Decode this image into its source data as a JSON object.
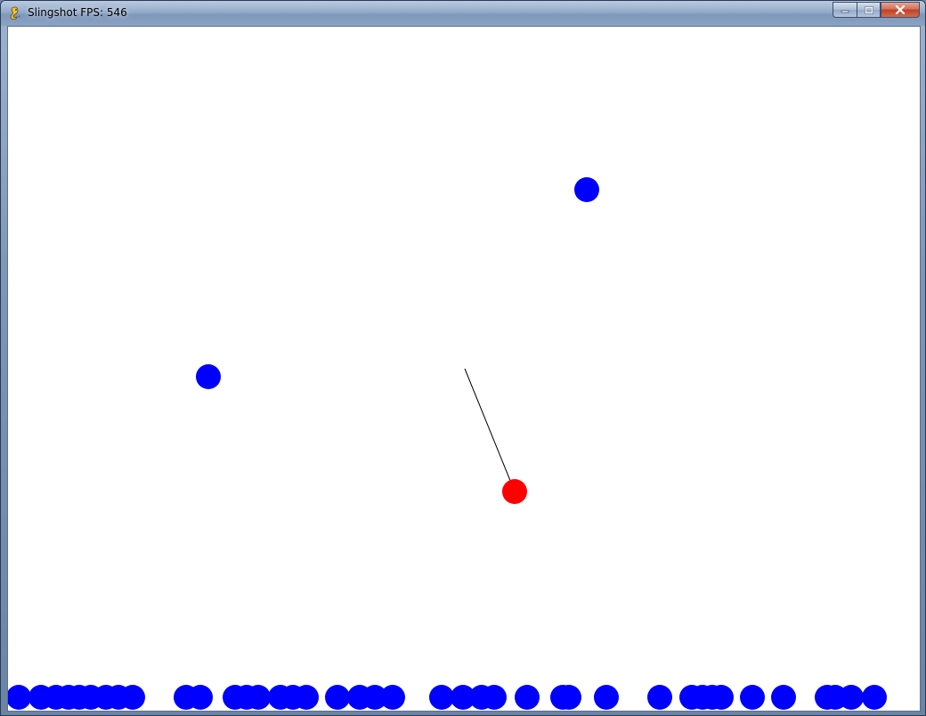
{
  "window": {
    "title": "Slingshot FPS: 546",
    "icon": "pygame-snake-icon",
    "controls": [
      "minimize",
      "maximize",
      "close"
    ]
  },
  "game": {
    "background": "#ffffff",
    "colors": {
      "planet": "#0000ff",
      "player_ball": "#ff0000",
      "aim_line": "#000000"
    }
  }
}
